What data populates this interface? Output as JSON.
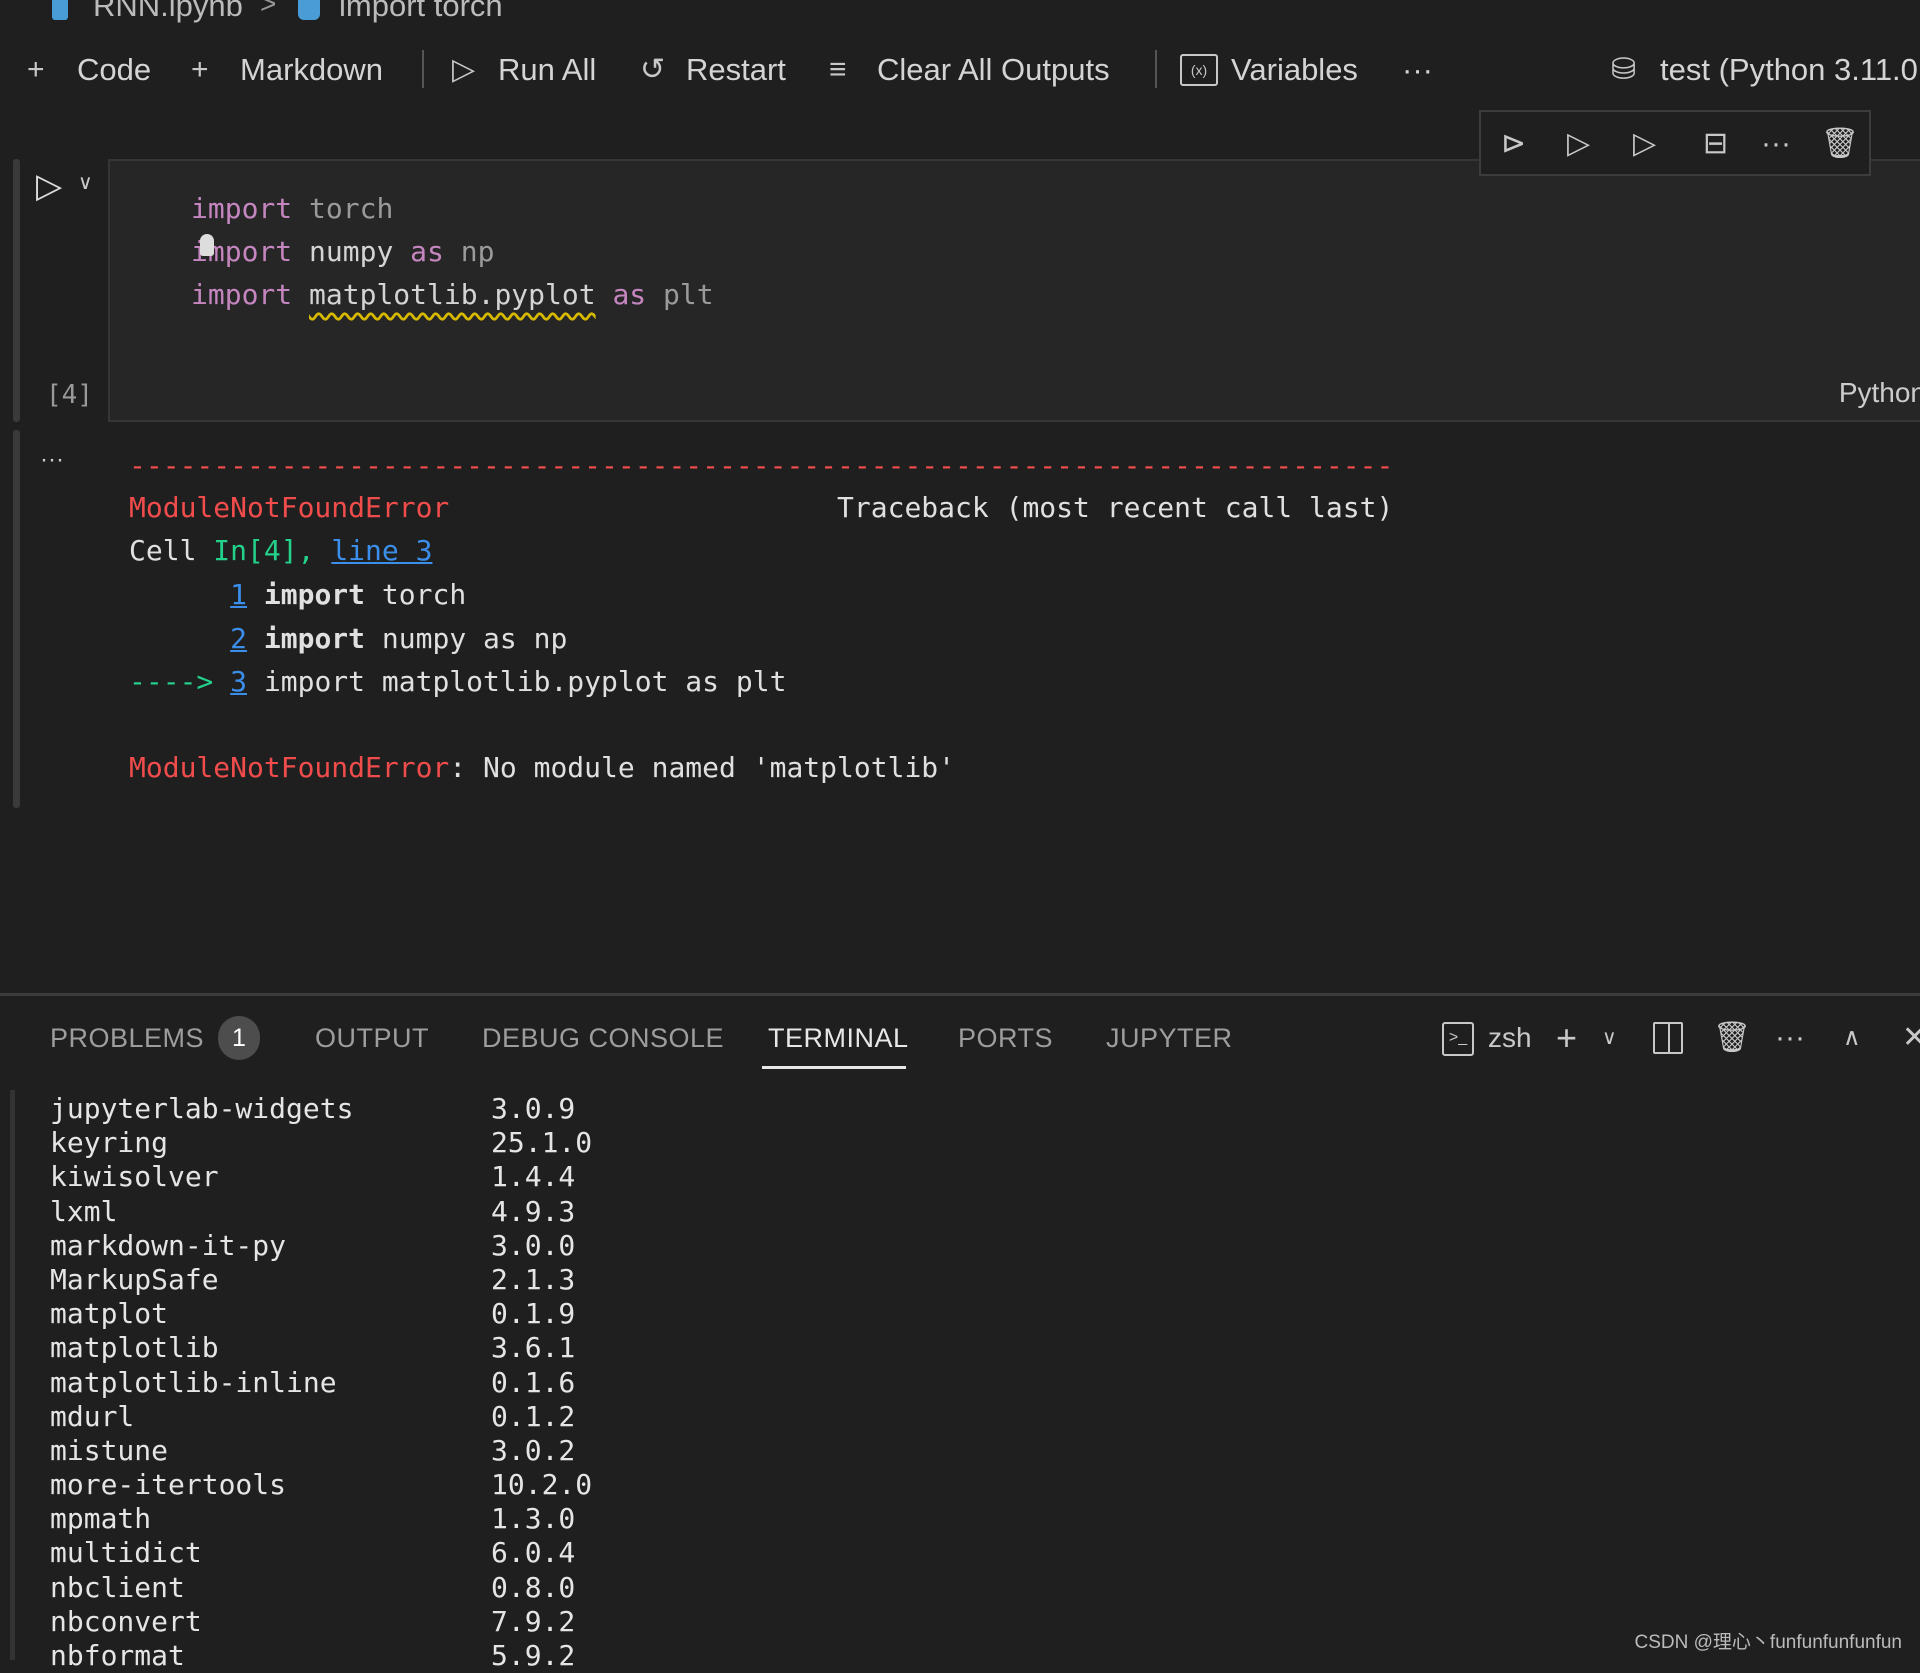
{
  "breadcrumb": {
    "file": "RNN.ipynb",
    "separator": ">",
    "symbol": "import torch"
  },
  "toolbar": {
    "code": "Code",
    "markdown": "Markdown",
    "run_all": "Run All",
    "restart": "Restart",
    "clear_outputs": "Clear All Outputs",
    "variables": "Variables",
    "more": "···",
    "kernel": "test (Python 3.11.0"
  },
  "cell": {
    "exec_count": "[4]",
    "language": "Python",
    "lines": [
      [
        {
          "t": "import",
          "c": "kw"
        },
        {
          "t": " ",
          "c": "id"
        },
        {
          "t": "torch",
          "c": "dim"
        }
      ],
      [
        {
          "t": "import",
          "c": "kw"
        },
        {
          "t": " numpy ",
          "c": "id"
        },
        {
          "t": "as",
          "c": "kw"
        },
        {
          "t": " ",
          "c": "id"
        },
        {
          "t": "np",
          "c": "dim"
        }
      ],
      [
        {
          "t": "import",
          "c": "kw"
        },
        {
          "t": " ",
          "c": "id"
        },
        {
          "t": "matplotlib.pyplot",
          "c": "id squig"
        },
        {
          "t": " ",
          "c": "id"
        },
        {
          "t": "as",
          "c": "kw"
        },
        {
          "t": " ",
          "c": "id"
        },
        {
          "t": "plt",
          "c": "dim"
        }
      ]
    ]
  },
  "output": {
    "more": "···",
    "dashes": "---------------------------------------------------------------------------",
    "error_name": "ModuleNotFoundError",
    "traceback": "                       Traceback (most recent call last)",
    "cell_label": "Cell ",
    "cell_in": "In[4], ",
    "cell_line": "line 3",
    "src": [
      {
        "prefix": "      ",
        "num": "1",
        "kw": "import",
        "rest": " torch"
      },
      {
        "prefix": "      ",
        "num": "2",
        "kw": "import",
        "rest": " numpy as np"
      }
    ],
    "arrow": "----> ",
    "arrow_num": "3",
    "arrow_rest": " import matplotlib.pyplot as plt",
    "final_name": "ModuleNotFoundError",
    "final_msg": ": No module named 'matplotlib'"
  },
  "panel": {
    "tabs": [
      "PROBLEMS",
      "OUTPUT",
      "DEBUG CONSOLE",
      "TERMINAL",
      "PORTS",
      "JUPYTER"
    ],
    "active_tab": "TERMINAL",
    "problems_count": "1",
    "shell": "zsh"
  },
  "terminal": [
    [
      "jupyterlab-widgets",
      "3.0.9"
    ],
    [
      "keyring",
      "25.1.0"
    ],
    [
      "kiwisolver",
      "1.4.4"
    ],
    [
      "lxml",
      "4.9.3"
    ],
    [
      "markdown-it-py",
      "3.0.0"
    ],
    [
      "MarkupSafe",
      "2.1.3"
    ],
    [
      "matplot",
      "0.1.9"
    ],
    [
      "matplotlib",
      "3.6.1"
    ],
    [
      "matplotlib-inline",
      "0.1.6"
    ],
    [
      "mdurl",
      "0.1.2"
    ],
    [
      "mistune",
      "3.0.2"
    ],
    [
      "more-itertools",
      "10.2.0"
    ],
    [
      "mpmath",
      "1.3.0"
    ],
    [
      "multidict",
      "6.0.4"
    ],
    [
      "nbclient",
      "0.8.0"
    ],
    [
      "nbconvert",
      "7.9.2"
    ],
    [
      "nbformat",
      "5.9.2"
    ]
  ],
  "watermark": "CSDN @理心丶funfunfunfunfun"
}
